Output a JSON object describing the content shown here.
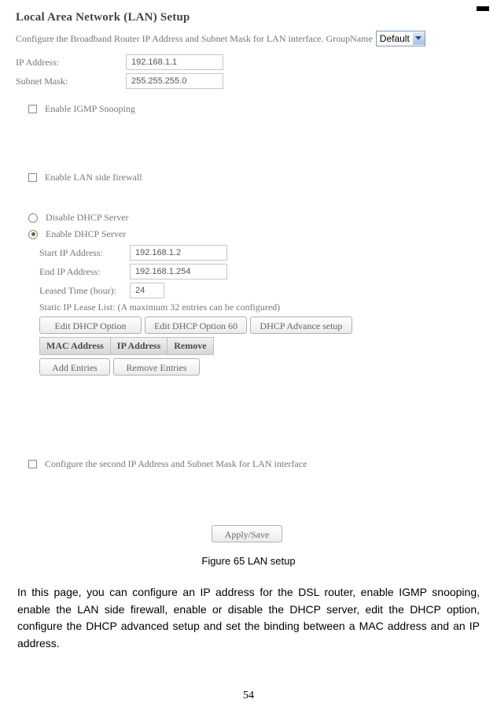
{
  "header": {
    "title": "Local Area Network (LAN) Setup",
    "description": "Configure the Broadband Router IP Address and Subnet Mask for LAN interface. GroupName",
    "group_name_selected": "Default"
  },
  "fields": {
    "ip_address_label": "IP Address:",
    "ip_address_value": "192.168.1.1",
    "subnet_mask_label": "Subnet Mask:",
    "subnet_mask_value": "255.255.255.0"
  },
  "checkboxes": {
    "igmp_snooping": "Enable IGMP Snooping",
    "lan_firewall": "Enable LAN side firewall",
    "second_ip": "Configure the second IP Address and Subnet Mask for LAN interface"
  },
  "dhcp": {
    "disable_label": "Disable DHCP Server",
    "enable_label": "Enable DHCP Server",
    "start_ip_label": "Start IP Address:",
    "start_ip_value": "192.168.1.2",
    "end_ip_label": "End IP Address:",
    "end_ip_value": "192.168.1.254",
    "leased_time_label": "Leased Time (hour):",
    "leased_time_value": "24",
    "static_lease_label": "Static IP Lease List: (A maximum 32 entries can be configured)"
  },
  "buttons": {
    "edit_dhcp_option": "Edit DHCP Option",
    "edit_dhcp_option_60": "Edit DHCP Option 60",
    "dhcp_advance_setup": "DHCP Advance setup",
    "add_entries": "Add Entries",
    "remove_entries": "Remove Entries",
    "apply_save": "Apply/Save"
  },
  "table_headers": {
    "mac": "MAC Address",
    "ip": "IP Address",
    "remove": "Remove"
  },
  "caption": "Figure 65 LAN setup",
  "body_paragraph": "In this page, you can configure an IP address for the DSL router, enable IGMP snooping, enable the LAN side firewall, enable or disable the DHCP server, edit the DHCP option, configure the DHCP advanced setup and set the binding between a MAC address and an IP address.",
  "page_number": "54"
}
